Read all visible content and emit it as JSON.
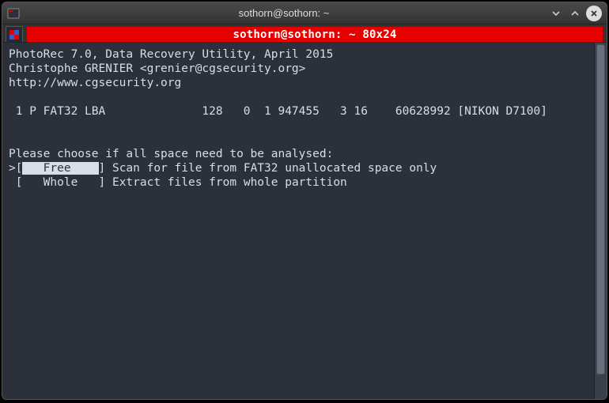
{
  "window": {
    "title": "sothorn@sothorn: ~"
  },
  "tab": {
    "label": "sothorn@sothorn: ~ 80x24"
  },
  "app": {
    "line1": "PhotoRec 7.0, Data Recovery Utility, April 2015",
    "line2": "Christophe GRENIER <grenier@cgsecurity.org>",
    "line3": "http://www.cgsecurity.org"
  },
  "partition": {
    "row": " 1 P FAT32 LBA              128   0  1 947455   3 16    60628992 [NIKON D7100]"
  },
  "prompt": "Please choose if all space need to be analysed:",
  "menu": [
    {
      "selected": true,
      "label": "   Free    ",
      "desc": "Scan for file from FAT32 unallocated space only"
    },
    {
      "selected": false,
      "label": "   Whole   ",
      "desc": "Extract files from whole partition"
    }
  ]
}
